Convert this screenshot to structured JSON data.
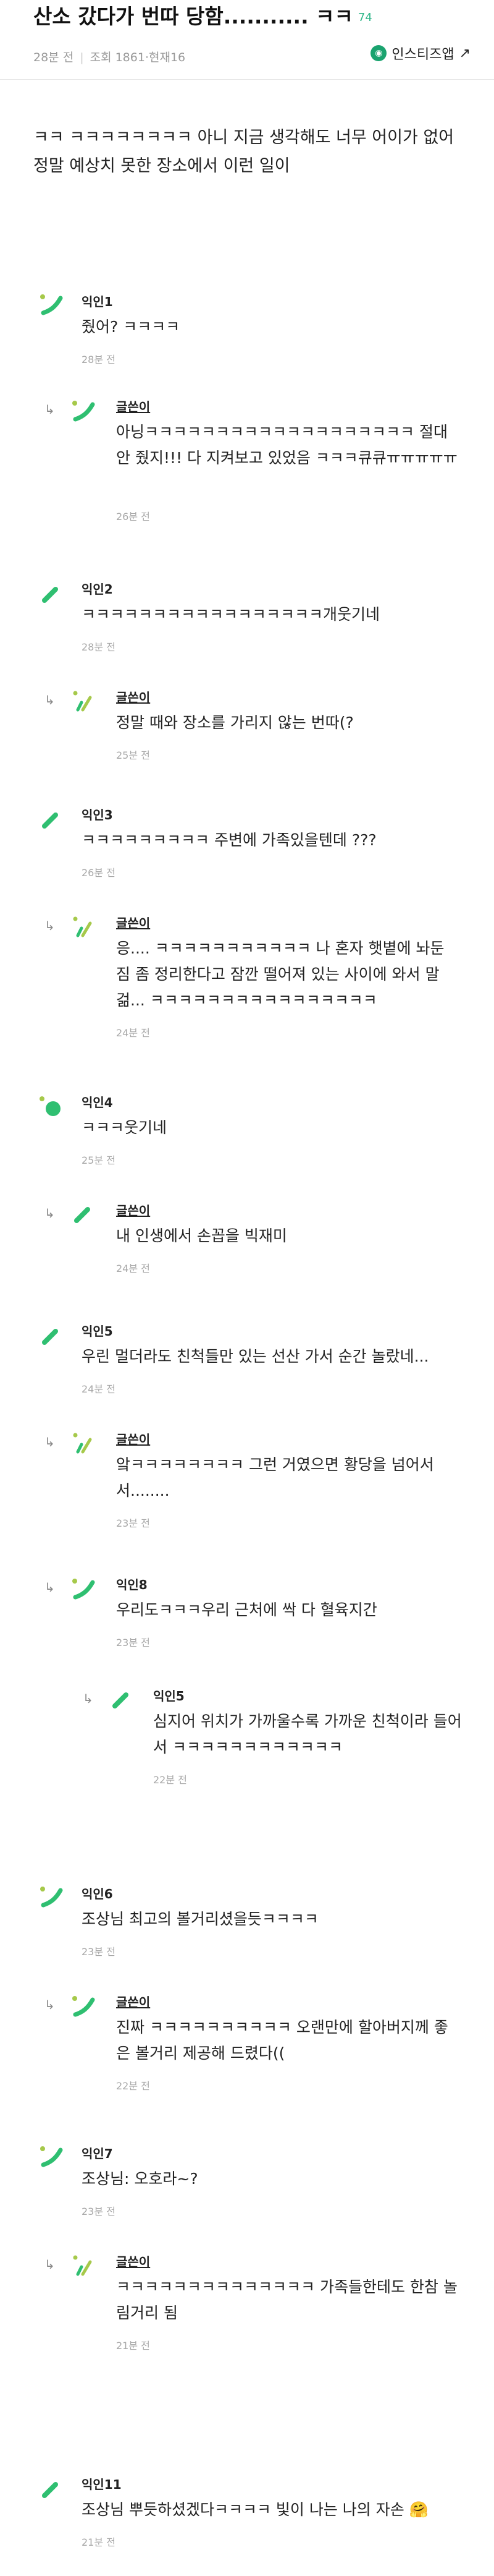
{
  "post": {
    "title": "산소 갔다가 번따 당함........... ㅋㅋ",
    "comment_count": "74",
    "time": "28분 전",
    "views": "조회 1861",
    "likes": "·현재16",
    "insta_label": "인스티즈앱",
    "body": "ㅋㅋ ㅋㅋㅋㅋㅋㅋㅋㅋ 아니 지금 생각해도 너무 어이가 없어 정말 예상치 못한 장소에서 이런 일이"
  },
  "colors": {
    "accent": "#31b78a",
    "brand": "#1aa36f",
    "leaf": "#2fbf71",
    "lime": "#a6c94a"
  },
  "comments": [
    {
      "nick": "익인1",
      "text": "줬어? ㅋㅋㅋㅋ",
      "time": "28분 전"
    },
    {
      "nick": "글쓴이",
      "text": "아닝ㅋㅋㅋㅋㅋㅋㅋㅋㅋㅋㅋㅋㅋㅋㅋㅋㅋㅋㅋ 절대 안 줬지!!! 다 지켜보고 있었음 ㅋㅋㅋ큐큐ㅠㅠㅠㅠㅠ",
      "time": "26분 전"
    },
    {
      "nick": "익인2",
      "text": "ㅋㅋㅋㅋㅋㅋㅋㅋㅋㅋㅋㅋㅋㅋㅋㅋㅋ개웃기네",
      "time": "28분 전"
    },
    {
      "nick": "글쓴이",
      "text": "정말 때와 장소를 가리지 않는 번따(?",
      "time": "25분 전"
    },
    {
      "nick": "익인3",
      "text": "ㅋㅋㅋㅋㅋㅋㅋㅋㅋ 주변에 가족있을텐데 ???",
      "time": "26분 전"
    },
    {
      "nick": "글쓴이",
      "text": "응.... ㅋㅋㅋㅋㅋㅋㅋㅋㅋㅋㅋ 나 혼자 햇볕에 놔둔 짐 좀 정리한다고 잠깐 떨어져 있는 사이에 와서 말걺... ㅋㅋㅋㅋㅋㅋㅋㅋㅋㅋㅋㅋㅋㅋㅋㅋ",
      "time": "24분 전"
    },
    {
      "nick": "익인4",
      "text": "ㅋㅋㅋ웃기네",
      "time": "25분 전"
    },
    {
      "nick": "글쓴이",
      "text": "내 인생에서 손꼽을 빅재미",
      "time": "24분 전"
    },
    {
      "nick": "익인5",
      "text": "우린 멀더라도 친척들만 있는 선산 가서 순간 놀랐네...",
      "time": "24분 전"
    },
    {
      "nick": "글쓴이",
      "text": "앜ㅋㅋㅋㅋㅋㅋㅋㅋ 그런 거였으면 황당을 넘어서서........",
      "time": "23분 전"
    },
    {
      "nick": "익인8",
      "text": "우리도ㅋㅋㅋ우리 근처에 싹 다 혈육지간",
      "time": "23분 전"
    },
    {
      "nick": "익인5",
      "text": "심지어 위치가 가까울수록 가까운 친척이라 들어서 ㅋㅋㅋㅋㅋㅋㅋㅋㅋㅋㅋㅋ",
      "time": "22분 전"
    },
    {
      "nick": "익인6",
      "text": "조상님 최고의 볼거리셨을듯ㅋㅋㅋㅋ",
      "time": "23분 전"
    },
    {
      "nick": "글쓴이",
      "text": "진짜 ㅋㅋㅋㅋㅋㅋㅋㅋㅋㅋ 오랜만에 할아버지께 좋은 볼거리 제공해 드렸다((",
      "time": "22분 전"
    },
    {
      "nick": "익인7",
      "text": "조상님: 오호라~?",
      "time": "23분 전"
    },
    {
      "nick": "글쓴이",
      "text": "ㅋㅋㅋㅋㅋㅋㅋㅋㅋㅋㅋㅋㅋㅋ 가족들한테도 한참 놀림거리 됨",
      "time": "21분 전"
    },
    {
      "nick": "익인11",
      "text": "조상님 뿌듯하셨겠다ㅋㅋㅋㅋ 빛이 나는 나의 자손",
      "time": "21분 전"
    }
  ]
}
